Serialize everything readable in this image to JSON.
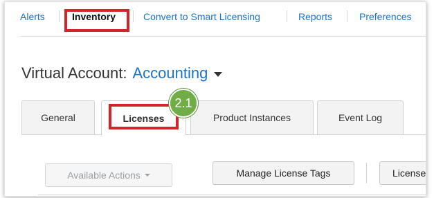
{
  "topnav": {
    "items": [
      {
        "label": "Alerts"
      },
      {
        "label": "Inventory"
      },
      {
        "label": "Convert to Smart Licensing"
      },
      {
        "label": "Reports"
      },
      {
        "label": "Preferences"
      }
    ],
    "active": "Inventory"
  },
  "virtual_account": {
    "label": "Virtual Account:",
    "value": "Accounting"
  },
  "tabs": [
    {
      "label": "General"
    },
    {
      "label": "Licenses"
    },
    {
      "label": "Product Instances"
    },
    {
      "label": "Event Log"
    }
  ],
  "active_tab": "Licenses",
  "step_badge": "2.1",
  "toolbar": {
    "available_actions": "Available Actions",
    "manage_tags": "Manage License Tags",
    "license_partial": "License"
  },
  "colors": {
    "link": "#1a73c8",
    "highlight": "#d3232b",
    "badge": "#70ad47"
  }
}
